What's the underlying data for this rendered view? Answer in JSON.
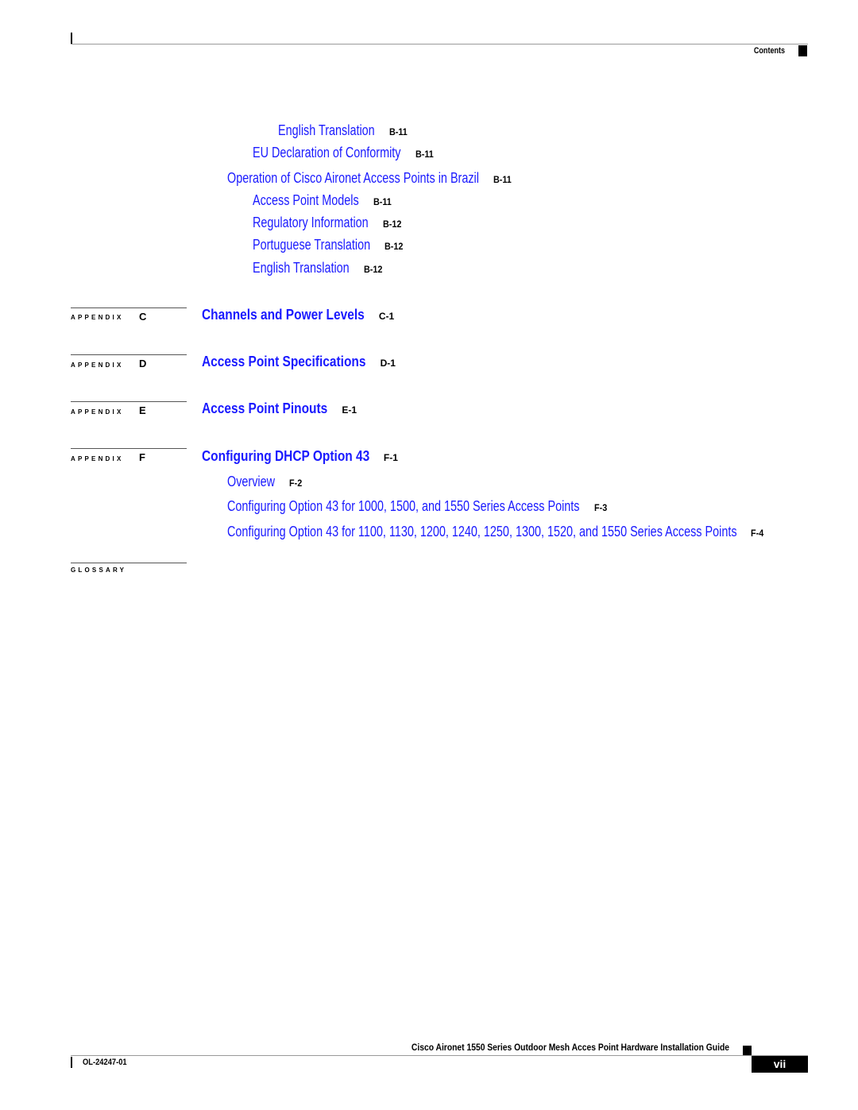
{
  "header": {
    "section_label": "Contents"
  },
  "toc": {
    "top_entries": [
      {
        "title": "English Translation",
        "page": "B-11",
        "level": 3
      },
      {
        "title": "EU Declaration of Conformity",
        "page": "B-11",
        "level": 2
      },
      {
        "title": "Operation of Cisco Aironet Access Points in Brazil",
        "page": "B-11",
        "level": 1
      },
      {
        "title": "Access Point Models",
        "page": "B-11",
        "level": 2
      },
      {
        "title": "Regulatory Information",
        "page": "B-12",
        "level": 2
      },
      {
        "title": "Portuguese Translation",
        "page": "B-12",
        "level": 2
      },
      {
        "title": "English Translation",
        "page": "B-12",
        "level": 2
      }
    ],
    "appendices": [
      {
        "label": "APPENDIX",
        "letter": "C",
        "title": "Channels and Power Levels",
        "page": "C-1"
      },
      {
        "label": "APPENDIX",
        "letter": "D",
        "title": "Access Point Specifications",
        "page": "D-1"
      },
      {
        "label": "APPENDIX",
        "letter": "E",
        "title": "Access Point Pinouts",
        "page": "E-1"
      },
      {
        "label": "APPENDIX",
        "letter": "F",
        "title": "Configuring DHCP Option 43",
        "page": "F-1",
        "subentries": [
          {
            "title": "Overview",
            "page": "F-2"
          },
          {
            "title": "Configuring Option 43 for 1000, 1500, and 1550 Series Access Points",
            "page": "F-3"
          },
          {
            "title": "Configuring Option 43 for 1100, 1130, 1200, 1240, 1250, 1300, 1520, and 1550 Series Access Points",
            "page": "F-4"
          }
        ]
      }
    ],
    "glossary_label": "GLOSSARY"
  },
  "footer": {
    "guide_title": "Cisco Aironet 1550 Series Outdoor Mesh Acces Point Hardware Installation Guide",
    "doc_number": "OL-24247-01",
    "page_number": "vii"
  },
  "colors": {
    "link": "#1a1aff",
    "text": "#000000"
  }
}
